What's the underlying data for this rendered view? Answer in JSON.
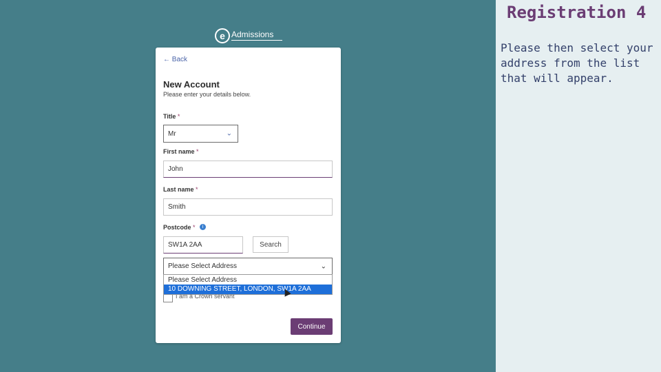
{
  "slide": {
    "title": "Registration 4",
    "body": "Please then select your address from the list that will appear."
  },
  "logo": {
    "letter": "e",
    "text": "Admissions"
  },
  "form": {
    "back_label": "← Back",
    "title": "New Account",
    "subtitle": "Please enter your details below.",
    "title_label": "Title",
    "title_value": "Mr",
    "first_name_label": "First name",
    "first_name_value": "John",
    "last_name_label": "Last name",
    "last_name_value": "Smith",
    "postcode_label": "Postcode",
    "postcode_value": "SW1A 2AA",
    "required_mark": "*",
    "search_label": "Search",
    "address_select_value": "Please Select Address",
    "address_options": [
      "Please Select Address",
      "10 DOWNING STREET, LONDON, SW1A 2AA"
    ],
    "crown_servant_label": "I am a Crown servant",
    "continue_label": "Continue",
    "info_icon": "i"
  },
  "colors": {
    "slide_bg_left": "#457e89",
    "slide_bg_right": "#e6eff1",
    "accent_purple": "#6b3d74",
    "highlight_blue": "#1e6fd9"
  },
  "icons": [
    "arrow-left-icon",
    "chevron-down-icon",
    "info-icon",
    "mouse-cursor-icon"
  ]
}
